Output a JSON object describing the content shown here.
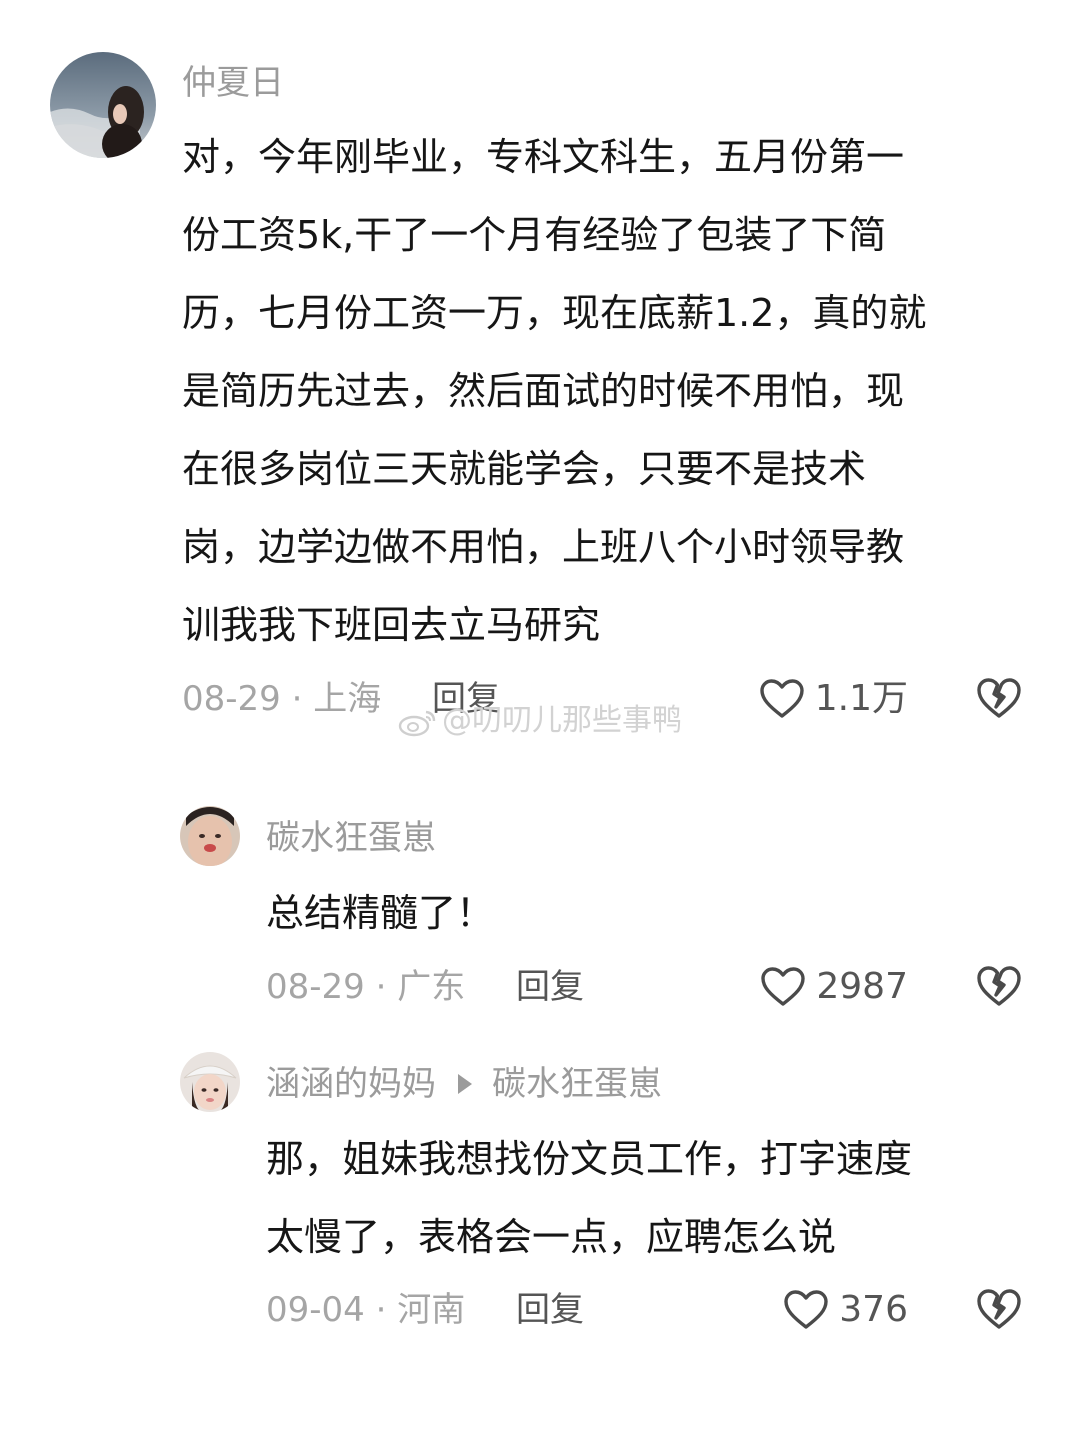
{
  "comments": [
    {
      "username": "仲夏日",
      "lines": [
        "对，今年刚毕业，专科文科生，五月份第一",
        "份工资5k,干了一个月有经验了包装了下简",
        "历，七月份工资一万，现在底薪1.2，真的就",
        "是简历先过去，然后面试的时候不用怕，现",
        "在很多岗位三天就能学会，只要不是技术",
        "岗，边学边做不用怕，上班八个小时领导教",
        "训我我下班回去立马研究"
      ],
      "meta": "08-29 · 上海",
      "reply_label": "回复",
      "likes": "1.1万"
    },
    {
      "username": "碳水狂蛋崽",
      "lines": [
        "总结精髓了！"
      ],
      "meta": "08-29 · 广东",
      "reply_label": "回复",
      "likes": "2987"
    },
    {
      "username": "涵涵的妈妈",
      "reply_to": "碳水狂蛋崽",
      "lines": [
        "那，姐妹我想找份文员工作，打字速度",
        "太慢了，表格会一点，应聘怎么说"
      ],
      "meta": "09-04 · 河南",
      "reply_label": "回复",
      "likes": "376"
    }
  ],
  "watermark": "@叨叨儿那些事鸭",
  "colors": {
    "text": "#161616",
    "username": "#9b9b9b",
    "meta": "#a5a5a5",
    "action": "#555555"
  },
  "icons": [
    "heart-icon",
    "broken-heart-icon",
    "reply-arrow-icon",
    "weibo-logo-icon"
  ]
}
